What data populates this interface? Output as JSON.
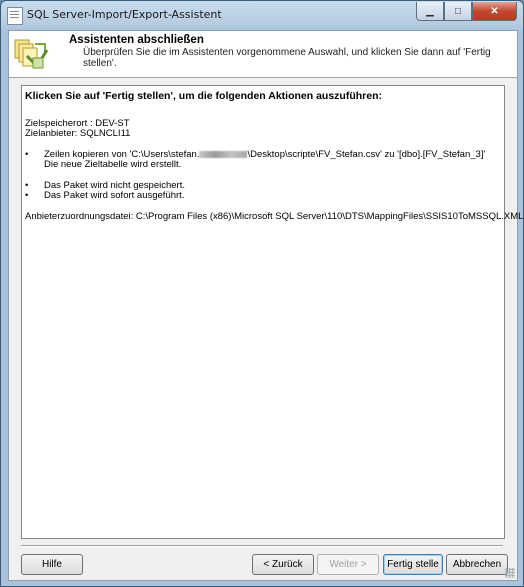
{
  "window": {
    "title": "SQL Server-Import/Export-Assistent"
  },
  "caption_buttons": {
    "minimize": "▁",
    "maximize": "□",
    "close": "✕"
  },
  "header": {
    "title": "Assistenten abschließen",
    "subtitle": "Überprüfen Sie die im Assistenten vorgenommene Auswahl, und klicken Sie dann auf 'Fertig stellen'."
  },
  "summary": {
    "heading": "Klicken Sie auf 'Fertig stellen', um die folgenden Aktionen auszuführen:",
    "target_location": "Zielspeicherort : DEV-ST",
    "target_provider": "Zielanbieter: SQLNCLI11",
    "copy_rows_prefix": "Zeilen kopieren von 'C:\\Users\\stefan.",
    "copy_rows_suffix": "\\Desktop\\scripte\\FV_Stefan.csv' zu '[dbo].[FV_Stefan_3]'",
    "new_table": "Die neue Zieltabelle wird erstellt.",
    "not_saved": "Das Paket wird nicht gespeichert.",
    "executed": "Das Paket wird sofort ausgeführt.",
    "mapping_file": "Anbieterzuordnungsdatei: C:\\Program Files (x86)\\Microsoft SQL Server\\110\\DTS\\MappingFiles\\SSIS10ToMSSQL.XML"
  },
  "buttons": {
    "help": "Hilfe",
    "back": "< Zurück",
    "next": "Weiter >",
    "finish": "Fertig stelle",
    "cancel": "Abbrechen"
  }
}
